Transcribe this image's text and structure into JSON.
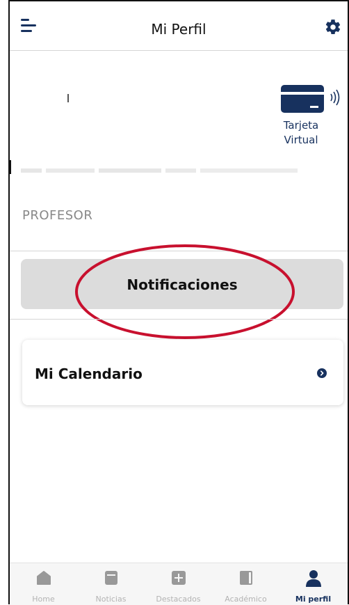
{
  "colors": {
    "accent": "#17315e",
    "button_bg": "#dcdcdc",
    "highlight": "#c8102e",
    "inactive": "#b3b3b3"
  },
  "header": {
    "title": "Mi Perfil",
    "menu_icon": "menu-icon",
    "settings_icon": "gear-icon"
  },
  "profile": {
    "virtual_card": {
      "label_line1": "Tarjeta",
      "label_line2": "Virtual",
      "icon": "credit-card-icon"
    },
    "role": "PROFESOR"
  },
  "actions": {
    "notifications_label": "Notificaciones",
    "calendar_label": "Mi Calendario",
    "calendar_icon": "chevron-right-icon"
  },
  "bottom_nav": {
    "items": [
      {
        "label": "Home",
        "icon": "home-icon"
      },
      {
        "label": "Noticias",
        "icon": "news-icon"
      },
      {
        "label": "Destacados",
        "icon": "plus-icon"
      },
      {
        "label": "Académico",
        "icon": "book-icon"
      },
      {
        "label": "Mi perfil",
        "icon": "user-icon",
        "active": true
      }
    ]
  }
}
